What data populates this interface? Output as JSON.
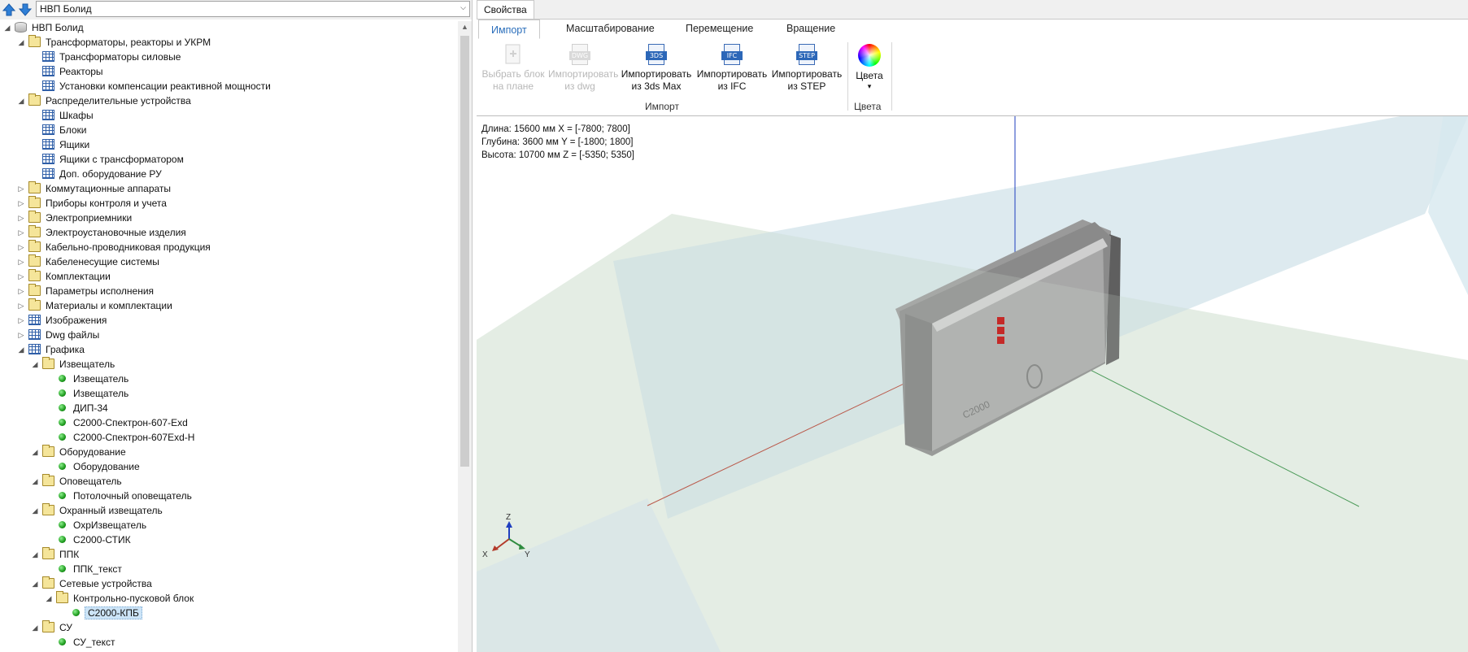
{
  "navigator": {
    "root_selector": "НВП Болид",
    "tree": [
      {
        "level": 0,
        "expander": "expanded",
        "icon": "database-icon",
        "label": "НВП Болид"
      },
      {
        "level": 1,
        "expander": "expanded",
        "icon": "folder-icon",
        "label": "Трансформаторы, реакторы и УКРМ"
      },
      {
        "level": 2,
        "expander": "none",
        "icon": "table-icon",
        "label": "Трансформаторы силовые"
      },
      {
        "level": 2,
        "expander": "none",
        "icon": "table-icon",
        "label": "Реакторы"
      },
      {
        "level": 2,
        "expander": "none",
        "icon": "table-icon",
        "label": "Установки компенсации реактивной мощности"
      },
      {
        "level": 1,
        "expander": "expanded",
        "icon": "folder-icon",
        "label": "Распределительные устройства"
      },
      {
        "level": 2,
        "expander": "none",
        "icon": "table-icon",
        "label": "Шкафы"
      },
      {
        "level": 2,
        "expander": "none",
        "icon": "table-icon",
        "label": "Блоки"
      },
      {
        "level": 2,
        "expander": "none",
        "icon": "table-icon",
        "label": "Ящики"
      },
      {
        "level": 2,
        "expander": "none",
        "icon": "table-icon",
        "label": "Ящики с трансформатором"
      },
      {
        "level": 2,
        "expander": "none",
        "icon": "table-icon",
        "label": "Доп. оборудование РУ"
      },
      {
        "level": 1,
        "expander": "collapsed",
        "icon": "folder-icon",
        "label": "Коммутационные аппараты"
      },
      {
        "level": 1,
        "expander": "collapsed",
        "icon": "folder-icon",
        "label": "Приборы контроля и учета"
      },
      {
        "level": 1,
        "expander": "collapsed",
        "icon": "folder-icon",
        "label": "Электроприемники"
      },
      {
        "level": 1,
        "expander": "collapsed",
        "icon": "folder-icon",
        "label": "Электроустановочные изделия"
      },
      {
        "level": 1,
        "expander": "collapsed",
        "icon": "folder-icon",
        "label": "Кабельно-проводниковая продукция"
      },
      {
        "level": 1,
        "expander": "collapsed",
        "icon": "folder-icon",
        "label": "Кабеленесущие системы"
      },
      {
        "level": 1,
        "expander": "collapsed",
        "icon": "folder-icon",
        "label": "Комплектации"
      },
      {
        "level": 1,
        "expander": "collapsed",
        "icon": "folder-icon",
        "label": "Параметры исполнения"
      },
      {
        "level": 1,
        "expander": "collapsed",
        "icon": "folder-icon",
        "label": "Материалы и комплектации"
      },
      {
        "level": 1,
        "expander": "collapsed",
        "icon": "table-icon",
        "label": "Изображения"
      },
      {
        "level": 1,
        "expander": "collapsed",
        "icon": "table-icon",
        "label": "Dwg файлы"
      },
      {
        "level": 1,
        "expander": "expanded",
        "icon": "table-icon",
        "label": "Графика"
      },
      {
        "level": 2,
        "expander": "expanded",
        "icon": "folder-icon",
        "label": "Извещатель"
      },
      {
        "level": 3,
        "expander": "none",
        "icon": "green-dot-icon",
        "label": "Извещатель"
      },
      {
        "level": 3,
        "expander": "none",
        "icon": "green-dot-icon",
        "label": "Извещатель"
      },
      {
        "level": 3,
        "expander": "none",
        "icon": "green-dot-icon",
        "label": "ДИП-34"
      },
      {
        "level": 3,
        "expander": "none",
        "icon": "green-dot-icon",
        "label": "С2000-Спектрон-607-Exd"
      },
      {
        "level": 3,
        "expander": "none",
        "icon": "green-dot-icon",
        "label": "С2000-Спектрон-607Exd-H"
      },
      {
        "level": 2,
        "expander": "expanded",
        "icon": "folder-icon",
        "label": "Оборудование"
      },
      {
        "level": 3,
        "expander": "none",
        "icon": "green-dot-icon",
        "label": "Оборудование"
      },
      {
        "level": 2,
        "expander": "expanded",
        "icon": "folder-icon",
        "label": "Оповещатель"
      },
      {
        "level": 3,
        "expander": "none",
        "icon": "green-dot-icon",
        "label": "Потолочный оповещатель"
      },
      {
        "level": 2,
        "expander": "expanded",
        "icon": "folder-icon",
        "label": "Охранный извещатель"
      },
      {
        "level": 3,
        "expander": "none",
        "icon": "green-dot-icon",
        "label": "ОхрИзвещатель"
      },
      {
        "level": 3,
        "expander": "none",
        "icon": "green-dot-icon",
        "label": "С2000-СТИК"
      },
      {
        "level": 2,
        "expander": "expanded",
        "icon": "folder-icon",
        "label": "ППК"
      },
      {
        "level": 3,
        "expander": "none",
        "icon": "green-dot-icon",
        "label": "ППК_текст"
      },
      {
        "level": 2,
        "expander": "expanded",
        "icon": "folder-icon",
        "label": "Сетевые устройства"
      },
      {
        "level": 3,
        "expander": "expanded",
        "icon": "folder-icon",
        "label": "Контрольно-пусковой блок"
      },
      {
        "level": 4,
        "expander": "none",
        "icon": "green-dot-icon",
        "label": "С2000-КПБ",
        "selected": true
      },
      {
        "level": 2,
        "expander": "expanded",
        "icon": "folder-icon",
        "label": "СУ"
      },
      {
        "level": 3,
        "expander": "none",
        "icon": "green-dot-icon",
        "label": "СУ_текст"
      }
    ]
  },
  "properties": {
    "tab_label": "Свойства",
    "ribbon_tabs": [
      {
        "label": "Импорт",
        "active": true
      },
      {
        "label": "Масштабирование",
        "active": false
      },
      {
        "label": "Перемещение",
        "active": false
      },
      {
        "label": "Вращение",
        "active": false
      }
    ],
    "ribbon_buttons": [
      {
        "line1": "Выбрать блок",
        "line2": "на плане",
        "icon": "select-block-icon",
        "tag": "",
        "enabled": false
      },
      {
        "line1": "Импортировать",
        "line2": "из dwg",
        "icon": "dwg-file-icon",
        "tag": "DWG",
        "enabled": false
      },
      {
        "line1": "Импортировать",
        "line2": "из 3ds Max",
        "icon": "3ds-file-icon",
        "tag": "3DS",
        "enabled": true
      },
      {
        "line1": "Импортировать",
        "line2": "из IFC",
        "icon": "ifc-file-icon",
        "tag": "IFC",
        "enabled": true
      },
      {
        "line1": "Импортировать",
        "line2": "из STEP",
        "icon": "step-file-icon",
        "tag": "STEP",
        "enabled": true
      }
    ],
    "colors_button": {
      "label": "Цвета",
      "dropdown_glyph": "▾"
    },
    "groups": {
      "import": "Импорт",
      "colors": "Цвета"
    },
    "dimensions": {
      "length_line": "Длина: 15600 мм  X = [-7800; 7800]",
      "depth_line": "Глубина: 3600 мм Y = [-1800; 1800]",
      "height_line": "Высота: 10700 мм Z = [-5350; 5350]"
    },
    "axis_labels": {
      "x": "X",
      "y": "Y",
      "z": "Z"
    },
    "colors": {
      "active_tab": "#2a6ebb",
      "axis_x": "#c0392b",
      "axis_y": "#2e8b3e",
      "axis_z": "#1f3fbf",
      "device_led": "#c00000"
    }
  }
}
